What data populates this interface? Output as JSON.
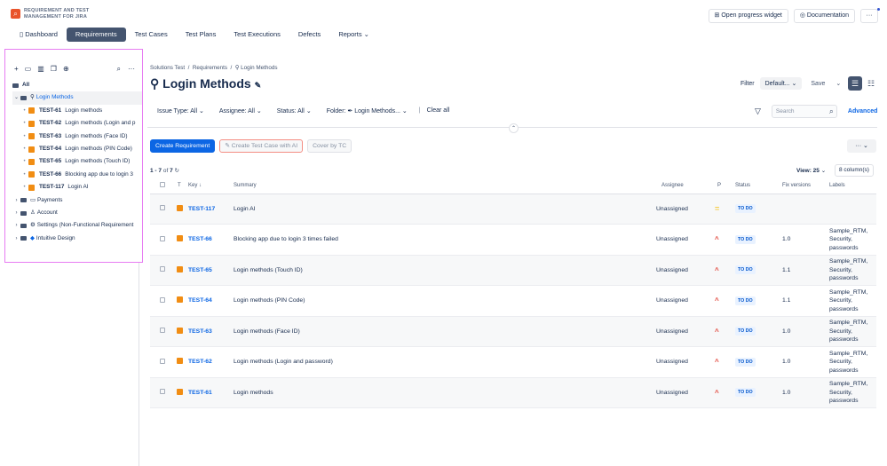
{
  "app": {
    "name_line1": "REQUIREMENT AND TEST",
    "name_line2": "MANAGEMENT FOR JIRA",
    "logo_glyph": "⌕"
  },
  "nav": {
    "dashboard": "Dashboard",
    "requirements": "Requirements",
    "test_cases": "Test Cases",
    "test_plans": "Test Plans",
    "test_executions": "Test Executions",
    "defects": "Defects",
    "reports": "Reports"
  },
  "top_right": {
    "progress_widget": "Open progress widget",
    "documentation": "Documentation",
    "more": "···"
  },
  "sidebar": {
    "all_label": "All",
    "login_methods": "Login Methods",
    "tests": [
      {
        "key": "TEST-61",
        "label": "Login methods"
      },
      {
        "key": "TEST-62",
        "label": "Login methods (Login and p"
      },
      {
        "key": "TEST-63",
        "label": "Login methods (Face ID)"
      },
      {
        "key": "TEST-64",
        "label": "Login methods (PIN Code)"
      },
      {
        "key": "TEST-65",
        "label": "Login methods (Touch ID)"
      },
      {
        "key": "TEST-66",
        "label": "Blocking app due to login 3"
      },
      {
        "key": "TEST-117",
        "label": "Login AI"
      }
    ],
    "payments": "Payments",
    "account": "Account",
    "settings": "Settings (Non-Functional Requirement",
    "intuitive_design": "Intuitive Design"
  },
  "breadcrumb": {
    "project": "Solutions Test",
    "section": "Requirements",
    "folder": "Login Methods"
  },
  "page": {
    "title": "Login Methods",
    "filter_label": "Filter",
    "filter_value": "Default...",
    "save": "Save"
  },
  "filters": {
    "issue_type": "Issue Type: All",
    "assignee": "Assignee: All",
    "status": "Status: All",
    "folder": "Folder: ✒ Login Methods...",
    "clear": "Clear all",
    "search_placeholder": "Search",
    "advanced": "Advanced"
  },
  "actions": {
    "create_requirement": "Create Requirement",
    "create_test_case_ai": "Create Test Case with AI",
    "cover_by_tc": "Cover by TC",
    "more": "···"
  },
  "list": {
    "range": "1 - 7",
    "of": "of",
    "total": "7",
    "view": "View: 25",
    "columns": "8 column(s)"
  },
  "table": {
    "headers": {
      "t": "T",
      "key": "Key ↓",
      "summary": "Summary",
      "assignee": "Assignee",
      "p": "P",
      "status": "Status",
      "fix_versions": "Fix versions",
      "labels": "Labels"
    },
    "rows": [
      {
        "key": "TEST-117",
        "summary": "Login AI",
        "assignee": "Unassigned",
        "priority": "=",
        "status": "TO DO",
        "fix": "",
        "labels": [
          "",
          "",
          ""
        ]
      },
      {
        "key": "TEST-66",
        "summary": "Blocking app due to login 3 times failed",
        "assignee": "Unassigned",
        "priority": "^",
        "status": "TO DO",
        "fix": "1.0",
        "labels": [
          "Sample_RTM,",
          "Security,",
          "passwords"
        ]
      },
      {
        "key": "TEST-65",
        "summary": "Login methods (Touch ID)",
        "assignee": "Unassigned",
        "priority": "^",
        "status": "TO DO",
        "fix": "1.1",
        "labels": [
          "Sample_RTM,",
          "Security,",
          "passwords"
        ]
      },
      {
        "key": "TEST-64",
        "summary": "Login methods (PIN Code)",
        "assignee": "Unassigned",
        "priority": "^",
        "status": "TO DO",
        "fix": "1.1",
        "labels": [
          "Sample_RTM,",
          "Security,",
          "passwords"
        ]
      },
      {
        "key": "TEST-63",
        "summary": "Login methods (Face ID)",
        "assignee": "Unassigned",
        "priority": "^",
        "status": "TO DO",
        "fix": "1.0",
        "labels": [
          "Sample_RTM,",
          "Security,",
          "passwords"
        ]
      },
      {
        "key": "TEST-62",
        "summary": "Login methods (Login and password)",
        "assignee": "Unassigned",
        "priority": "^",
        "status": "TO DO",
        "fix": "1.0",
        "labels": [
          "Sample_RTM,",
          "Security,",
          "passwords"
        ]
      },
      {
        "key": "TEST-61",
        "summary": "Login methods",
        "assignee": "Unassigned",
        "priority": "^",
        "status": "TO DO",
        "fix": "1.0",
        "labels": [
          "Sample_RTM,",
          "Security,",
          "passwords"
        ]
      }
    ]
  },
  "colors": {
    "accent": "#0c66e4",
    "active_nav": "#44546f",
    "test_icon": "#f18d13",
    "sidebar_highlight": "#e77cf2"
  }
}
